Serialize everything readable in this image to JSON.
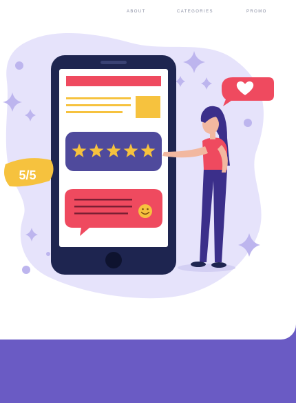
{
  "nav": {
    "items": [
      {
        "label": "ABOUT"
      },
      {
        "label": "CATEGORIES"
      },
      {
        "label": "PROMO"
      }
    ]
  },
  "illustration": {
    "rating_badge": "5/5",
    "stars_rating": 5,
    "stars_max": 5
  },
  "colors": {
    "brand_purple": "#6a5bc4",
    "blob_lavender": "#e6e3fb",
    "phone_navy": "#1e2550",
    "star_yellow": "#f6c23e",
    "accent_red": "#ef4a5f",
    "rating_panel": "#4f4a9c"
  },
  "icons": [
    "star-icon",
    "heart-icon",
    "smiley-icon",
    "sparkle-icon"
  ]
}
